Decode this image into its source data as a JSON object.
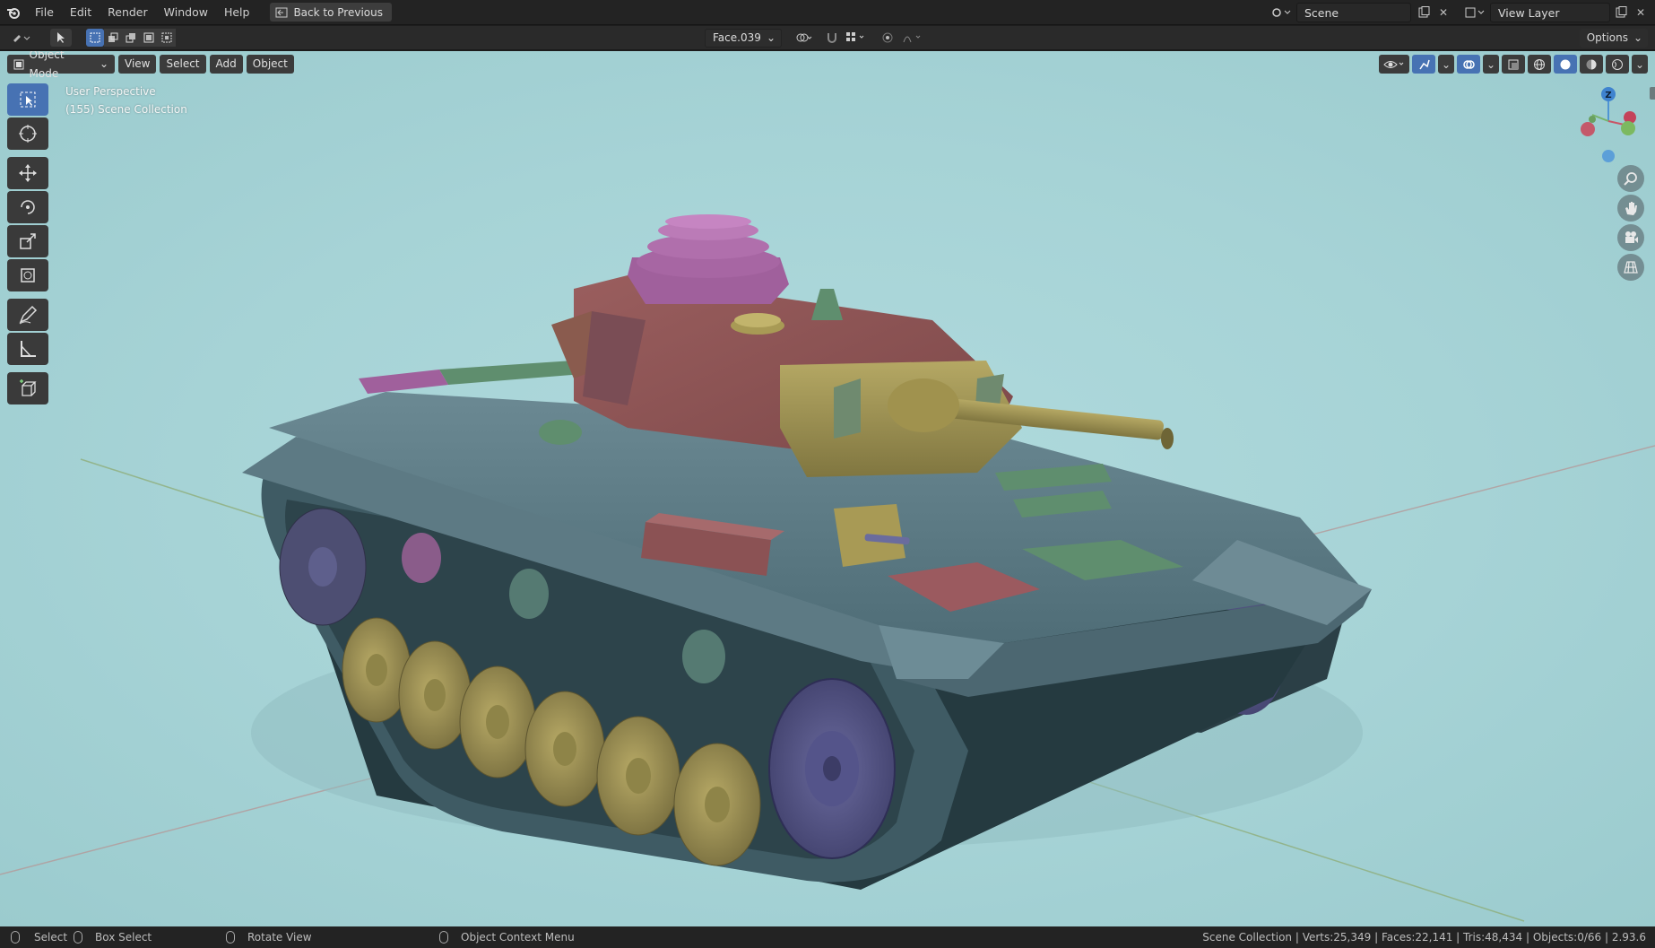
{
  "menu": [
    "File",
    "Edit",
    "Render",
    "Window",
    "Help"
  ],
  "back_button": "Back to Previous",
  "scene": {
    "label": "Scene"
  },
  "view_layer": {
    "label": "View Layer"
  },
  "toolbar": {
    "face_dropdown": "Face.039",
    "options": "Options"
  },
  "viewport": {
    "mode": "Object Mode",
    "menus": {
      "view": "View",
      "select": "Select",
      "add": "Add",
      "object": "Object"
    },
    "overlay_line1": "User Perspective",
    "overlay_line2": "(155) Scene Collection",
    "gizmo": {
      "z": "Z"
    }
  },
  "statusbar": {
    "select": "Select",
    "box_select": "Box Select",
    "rotate_view": "Rotate View",
    "context_menu": "Object Context Menu",
    "stats": "Scene Collection | Verts:25,349 | Faces:22,141 | Tris:48,434 | Objects:0/66 | 2.93.6"
  },
  "colors": {
    "accent": "#4772b3",
    "viewport_bg": "#a6d3d6",
    "hull": "#53707a",
    "turret": "#8b5254",
    "olive": "#a89a55",
    "sprocket": "#5b5a8a"
  }
}
